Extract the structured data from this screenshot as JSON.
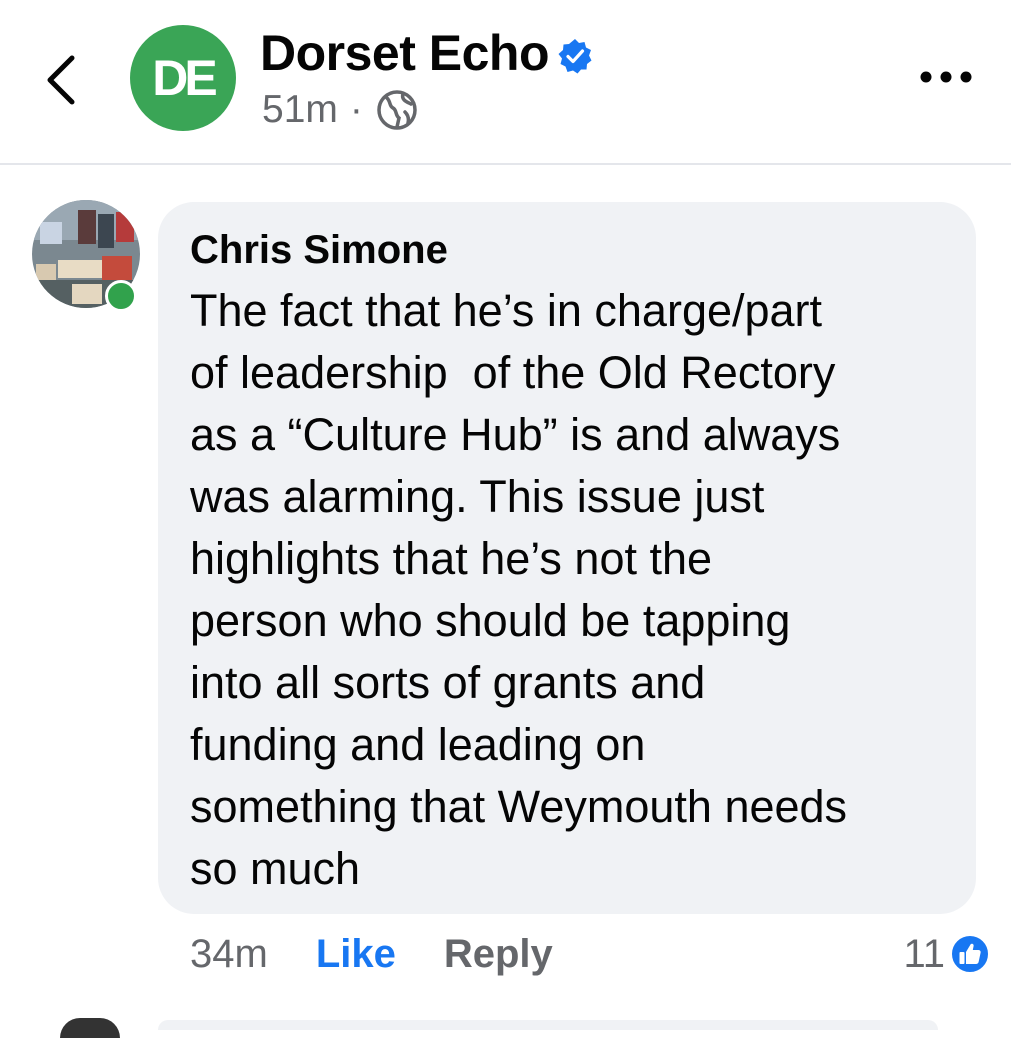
{
  "header": {
    "back_icon": "chevron-left-icon",
    "page_avatar_initials": "DE",
    "page_name": "Dorset Echo",
    "verified_icon": "verified-badge-icon",
    "post_time": "51m",
    "separator": "·",
    "audience_icon": "globe-icon",
    "more_icon": "more-options-icon"
  },
  "comment": {
    "author": "Chris Simone",
    "online": true,
    "text": "The fact that he’s in charge/part\nof leadership  of the Old Rectory\nas a “Culture Hub” is and always\nwas alarming. This issue just\nhighlights that he’s not the\nperson who should be tapping\ninto all sorts of grants and\nfunding and leading on\nsomething that Weymouth needs\nso much",
    "time": "34m",
    "like_label": "Like",
    "reply_label": "Reply",
    "reaction_count": "11",
    "reaction_icon": "like-reaction-icon"
  },
  "colors": {
    "brand_green": "#3aa556",
    "facebook_blue": "#1877f2",
    "bubble_bg": "#f0f2f5",
    "meta_gray": "#65676b",
    "online_green": "#31a24c"
  }
}
